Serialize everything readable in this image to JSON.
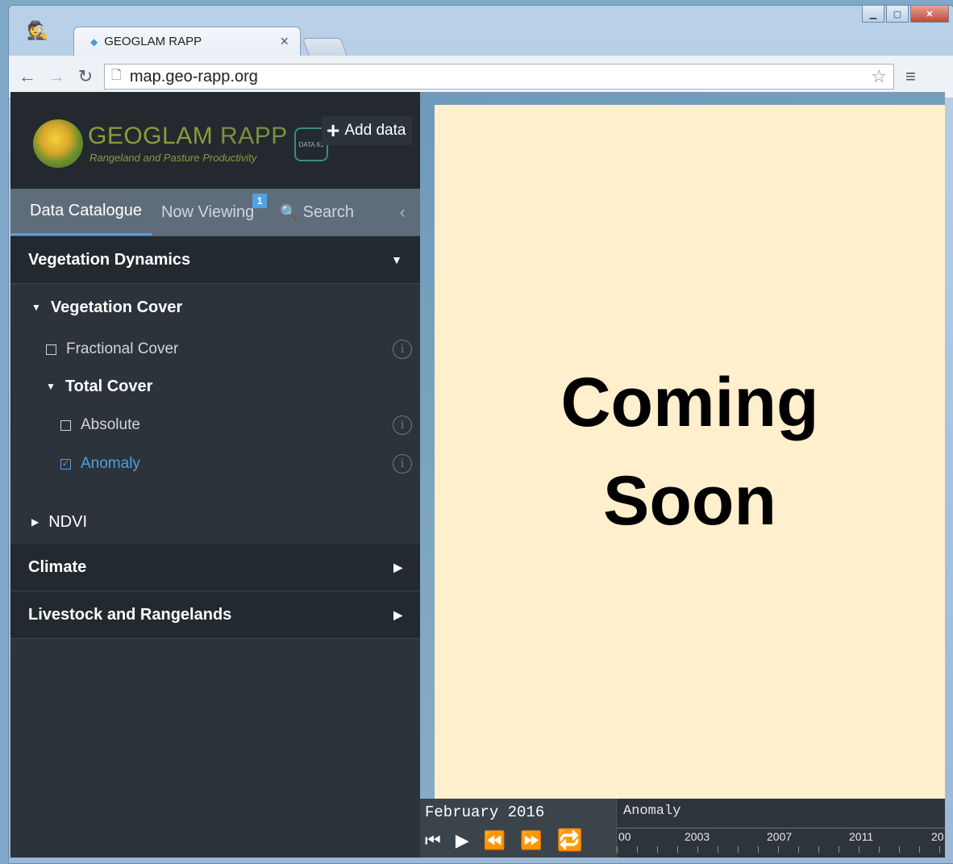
{
  "browser": {
    "tab_title": "GEOGLAM RAPP",
    "tab_close": "×",
    "url": "map.geo-rapp.org"
  },
  "brand": {
    "title_main": "GEOGLAM",
    "title_rapp": "RAPP",
    "subtitle": "Rangeland and Pasture Productivity",
    "partner_logo": "DATA 61",
    "add_data_label": "Add data"
  },
  "tabs": {
    "data_catalogue": "Data Catalogue",
    "now_viewing": "Now Viewing",
    "now_viewing_count": "1",
    "search": "Search"
  },
  "catalogue": {
    "vegetation_dynamics": "Vegetation Dynamics",
    "vegetation_cover": "Vegetation Cover",
    "fractional_cover": "Fractional Cover",
    "total_cover": "Total Cover",
    "absolute": "Absolute",
    "anomaly": "Anomaly",
    "ndvi": "NDVI",
    "climate": "Climate",
    "livestock": "Livestock and Rangelands"
  },
  "map_overlay": {
    "line1": "Coming",
    "line2": "Soon"
  },
  "timeline": {
    "date": "February 2016",
    "layer_name": "Anomaly",
    "ticks": [
      "00",
      "2003",
      "2007",
      "2011",
      "20"
    ]
  },
  "icons": {
    "info": "i",
    "checkbox_checked": "✓"
  }
}
